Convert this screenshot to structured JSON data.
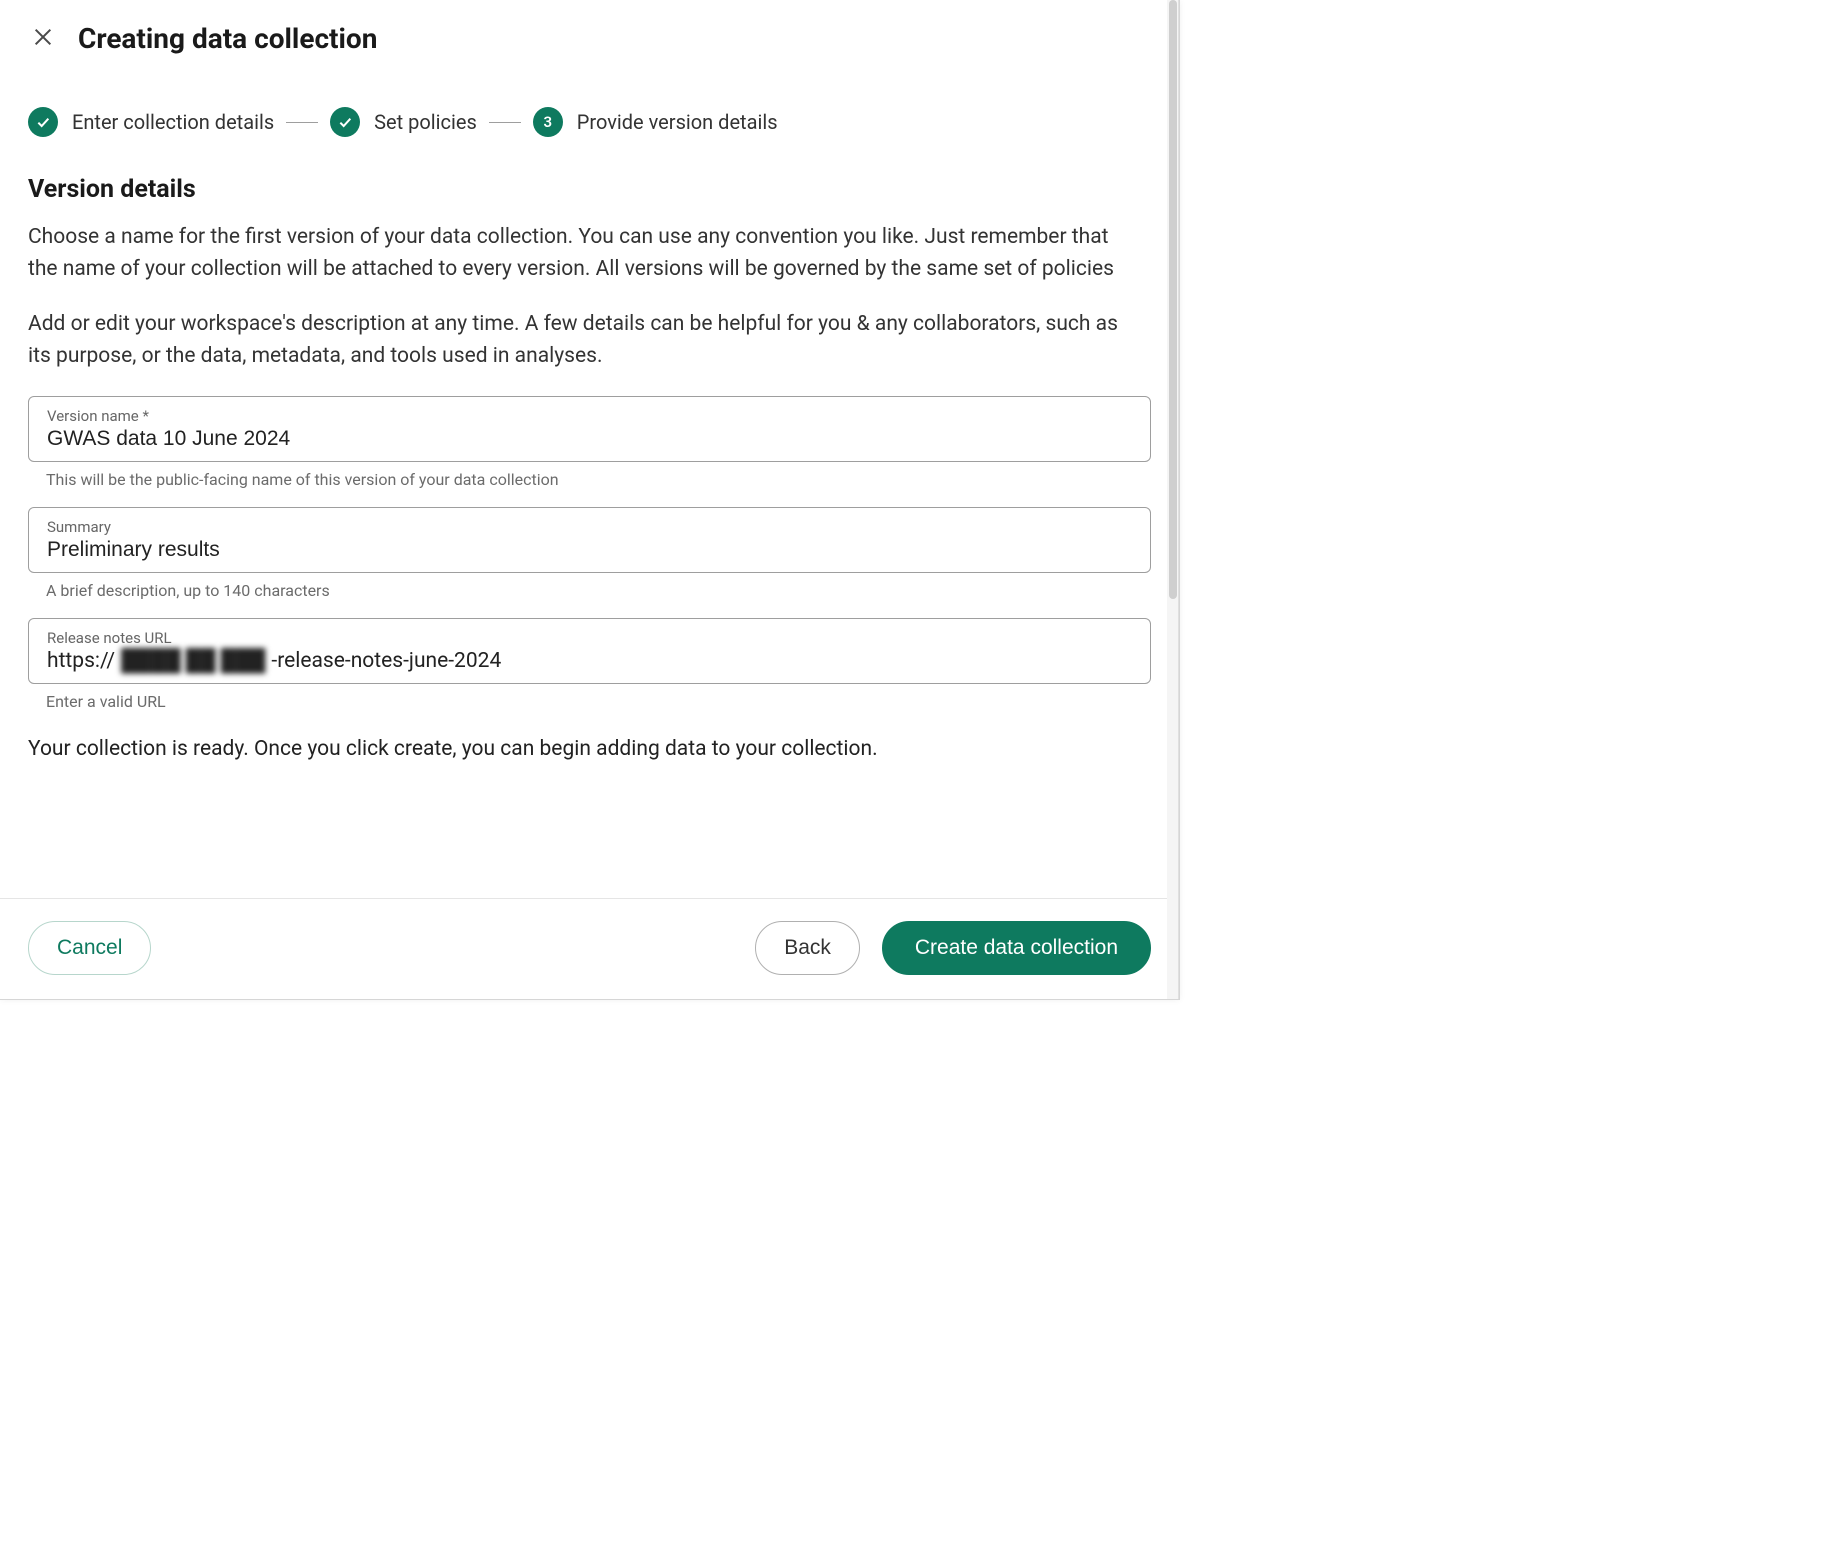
{
  "header": {
    "title": "Creating data collection"
  },
  "stepper": {
    "steps": [
      {
        "label": "Enter collection details",
        "state": "done"
      },
      {
        "label": "Set policies",
        "state": "done"
      },
      {
        "label": "Provide version details",
        "state": "current",
        "number": "3"
      }
    ]
  },
  "section": {
    "title": "Version details",
    "para1": "Choose a name for the first version of your data collection. You can use any convention you like. Just remember that the name of your collection will be attached to every version. All versions will be governed by the same set of policies",
    "para2": "Add or edit your workspace's description at any time. A few details can be helpful for you & any collaborators, such as its purpose, or the data, metadata, and tools used in analyses."
  },
  "fields": {
    "versionName": {
      "label": "Version name *",
      "value": "GWAS data 10 June 2024",
      "helper": "This will be the public-facing name of this version of your data collection"
    },
    "summary": {
      "label": "Summary",
      "value": "Preliminary results",
      "helper": "A brief description, up to 140 characters"
    },
    "releaseNotes": {
      "label": "Release notes URL",
      "prefix": "https://",
      "midBlur": "████ ██ ███",
      "suffix": "-release-notes-june-2024",
      "helper": "Enter a valid URL"
    }
  },
  "readyText": "Your collection is ready. Once you click create, you can begin adding data to your collection.",
  "footer": {
    "cancel": "Cancel",
    "back": "Back",
    "create": "Create data collection"
  }
}
